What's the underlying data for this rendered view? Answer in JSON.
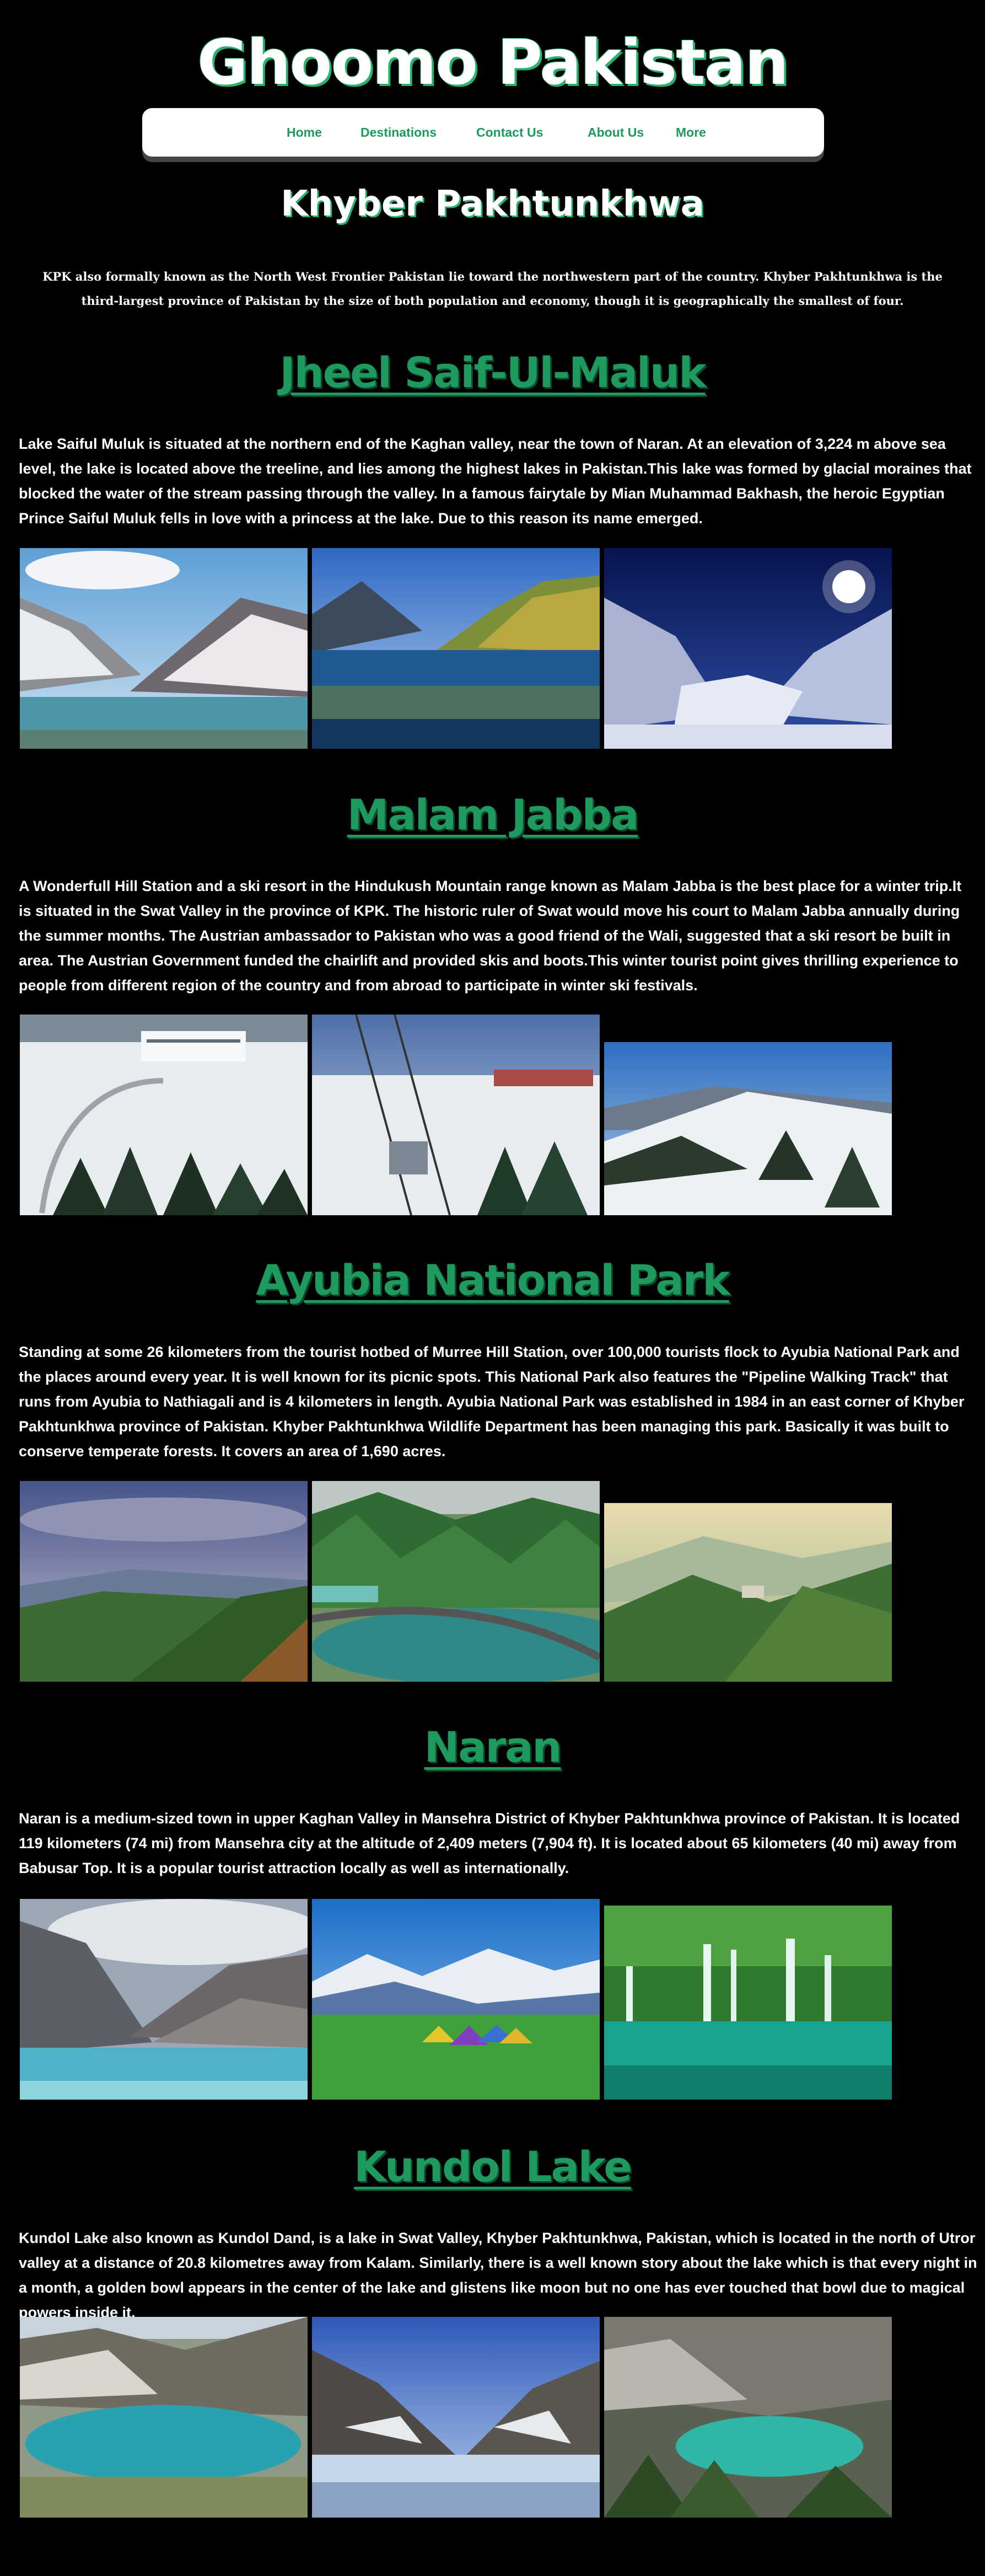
{
  "site": {
    "title": "Ghoomo Pakistan"
  },
  "nav": {
    "items": [
      "Home",
      "Destinations",
      "Contact Us",
      "About Us",
      "More"
    ]
  },
  "region": {
    "title": "Khyber  Pakhtunkhwa",
    "intro": "KPK also formally known as the North West Frontier Pakistan lie toward the northwestern part of the country. Khyber Pakhtunkhwa is the third-largest province of Pakistan by the size of both population and economy, though it is geographically the smallest of four."
  },
  "sections": [
    {
      "title": "Jheel Saif-Ul-Maluk",
      "text": "Lake Saiful Muluk is situated at the northern end of the Kaghan valley, near the town of Naran. At an elevation of 3,224 m above sea level, the lake is located above the treeline, and lies among the highest lakes in Pakistan.This lake was formed by glacial moraines that blocked the water of the stream passing through the valley. In a famous fairytale by Mian Muhammad Bakhash, the heroic Egyptian Prince Saiful Muluk fells in love with a princess at the lake. Due to this reason its name emerged."
    },
    {
      "title": "Malam Jabba",
      "text": "A Wonderfull Hill Station and a ski resort in the Hindukush Mountain range known as Malam Jabba is the best place for a winter trip.It is situated in the Swat Valley in the province of KPK. The historic ruler of Swat would move his court to Malam Jabba annually during the summer months. The Austrian ambassador to Pakistan who was a good friend of the Wali, suggested that a ski resort be built in area. The Austrian Government funded the chairlift and provided skis and boots.This winter tourist point gives thrilling experience to people from different region of the country and from abroad to participate in winter ski festivals."
    },
    {
      "title": "Ayubia National Park",
      "text": "Standing at some 26 kilometers from the tourist hotbed of Murree Hill Station, over 100,000 tourists flock to Ayubia National Park and the places around every year. It is well known for its picnic spots. This National Park also features the \"Pipeline Walking Track\" that runs from Ayubia to Nathiagali and is 4 kilometers in length. Ayubia National Park was established in 1984 in an east corner of Khyber Pakhtunkhwa province of Pakistan. Khyber Pakhtunkhwa Wildlife Department has been managing this park. Basically it was built to conserve temperate forests. It covers an area of 1,690 acres."
    },
    {
      "title": "Naran",
      "text": "Naran is a medium-sized town in upper Kaghan Valley in Mansehra District of Khyber Pakhtunkhwa province of Pakistan. It is located 119 kilometers (74 mi) from Mansehra city at the altitude of 2,409 meters (7,904 ft). It is located about 65 kilometers (40 mi) away from Babusar Top. It is a popular tourist attraction locally as well as internationally."
    },
    {
      "title": "Kundol Lake",
      "text": "Kundol Lake also known as Kundol Dand, is a lake in Swat Valley, Khyber Pakhtunkhwa, Pakistan, which is located in the north of Utror valley at a distance of 20.8 kilometres away from Kalam. Similarly, there is a well known story about the lake which is that every night in a month, a golden bowl appears in the center of the lake and glistens like moon but no one has ever touched that bowl due to magical powers inside it."
    }
  ],
  "colors": {
    "background": "#000000",
    "accent_green": "#1f9a5e",
    "nav_background": "#ffffff"
  }
}
